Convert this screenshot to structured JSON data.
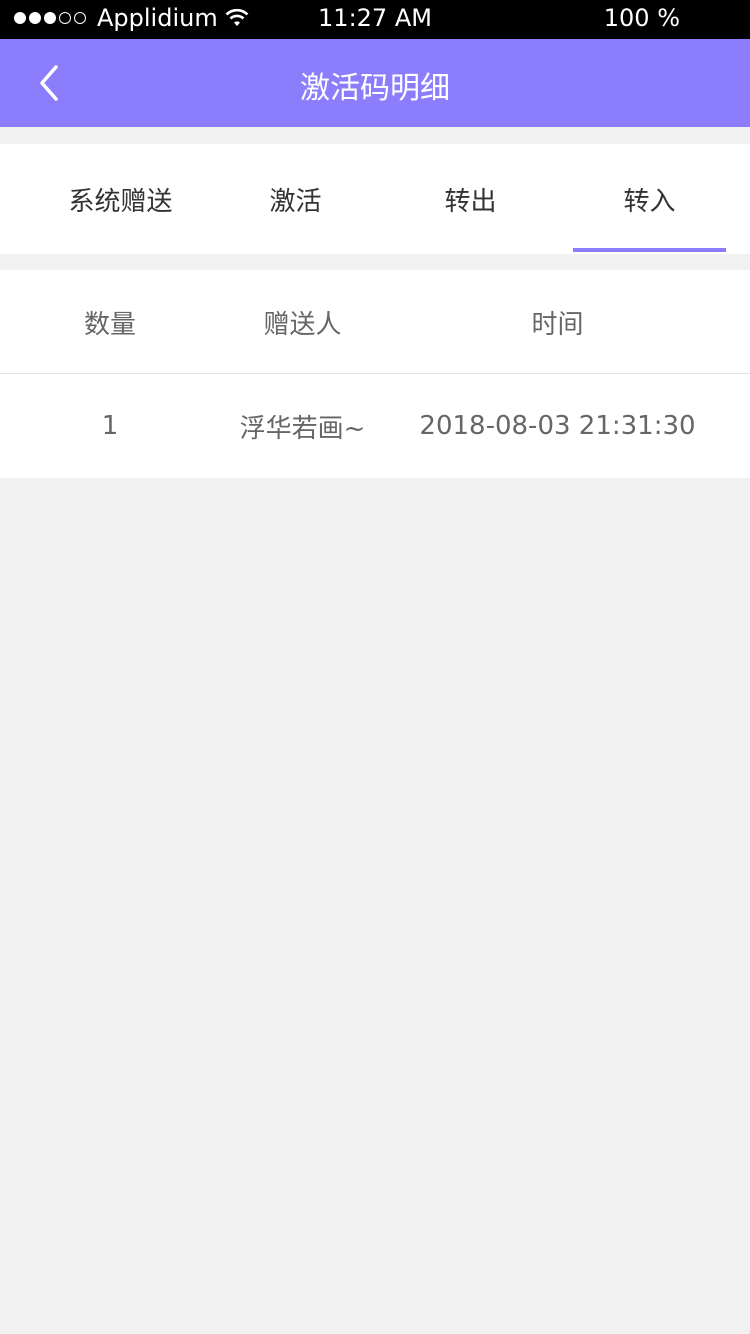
{
  "status_bar": {
    "carrier": "Applidium",
    "time": "11:27 AM",
    "battery": "100 %"
  },
  "nav": {
    "title": "激活码明细",
    "back_icon": "chevron-left-icon"
  },
  "tabs": [
    {
      "label": "系统赠送",
      "active": false
    },
    {
      "label": "激活",
      "active": false
    },
    {
      "label": "转出",
      "active": false
    },
    {
      "label": "转入",
      "active": true
    }
  ],
  "table": {
    "headers": [
      "数量",
      "赠送人",
      "时间"
    ],
    "rows": [
      [
        "1",
        "浮华若画~",
        "2018-08-03 21:31:30"
      ]
    ]
  },
  "colors": {
    "accent": "#8c7dfd",
    "background": "#f1f1f1"
  }
}
